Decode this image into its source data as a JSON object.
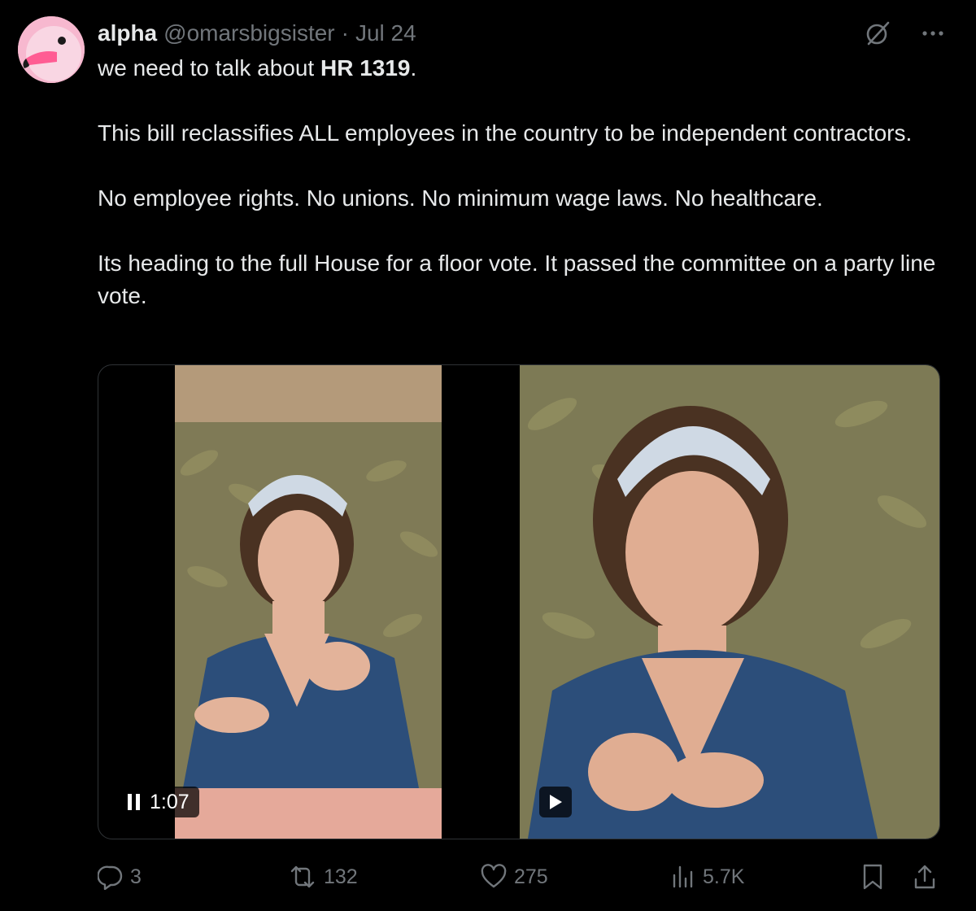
{
  "author": {
    "name": "alpha",
    "handle": "@omarsbigsister",
    "separator": "·",
    "date": "Jul 24"
  },
  "post": {
    "line1_prefix": "we need to talk about ",
    "line1_bold": "HR 1319",
    "line1_suffix": ".",
    "paragraph2": "This bill reclassifies ALL employees in the country to be independent contractors.",
    "paragraph3": "No employee rights. No unions. No minimum wage laws. No healthcare.",
    "paragraph4": "Its heading to the full House for a floor vote. It passed the committee on a party line vote."
  },
  "media": {
    "video1": {
      "timer": "1:07",
      "state": "playing"
    },
    "video2": {
      "state": "paused"
    }
  },
  "actions": {
    "replies": "3",
    "reposts": "132",
    "likes": "275",
    "views": "5.7K"
  },
  "colors": {
    "background": "#000000",
    "text": "#e7e9ea",
    "muted": "#71767b",
    "border": "#2f3336",
    "avatar": "#f7c6d8"
  },
  "icons": [
    "grok-icon",
    "more-icon",
    "reply-icon",
    "repost-icon",
    "like-icon",
    "views-icon",
    "bookmark-icon",
    "share-icon",
    "pause-icon",
    "play-icon"
  ]
}
